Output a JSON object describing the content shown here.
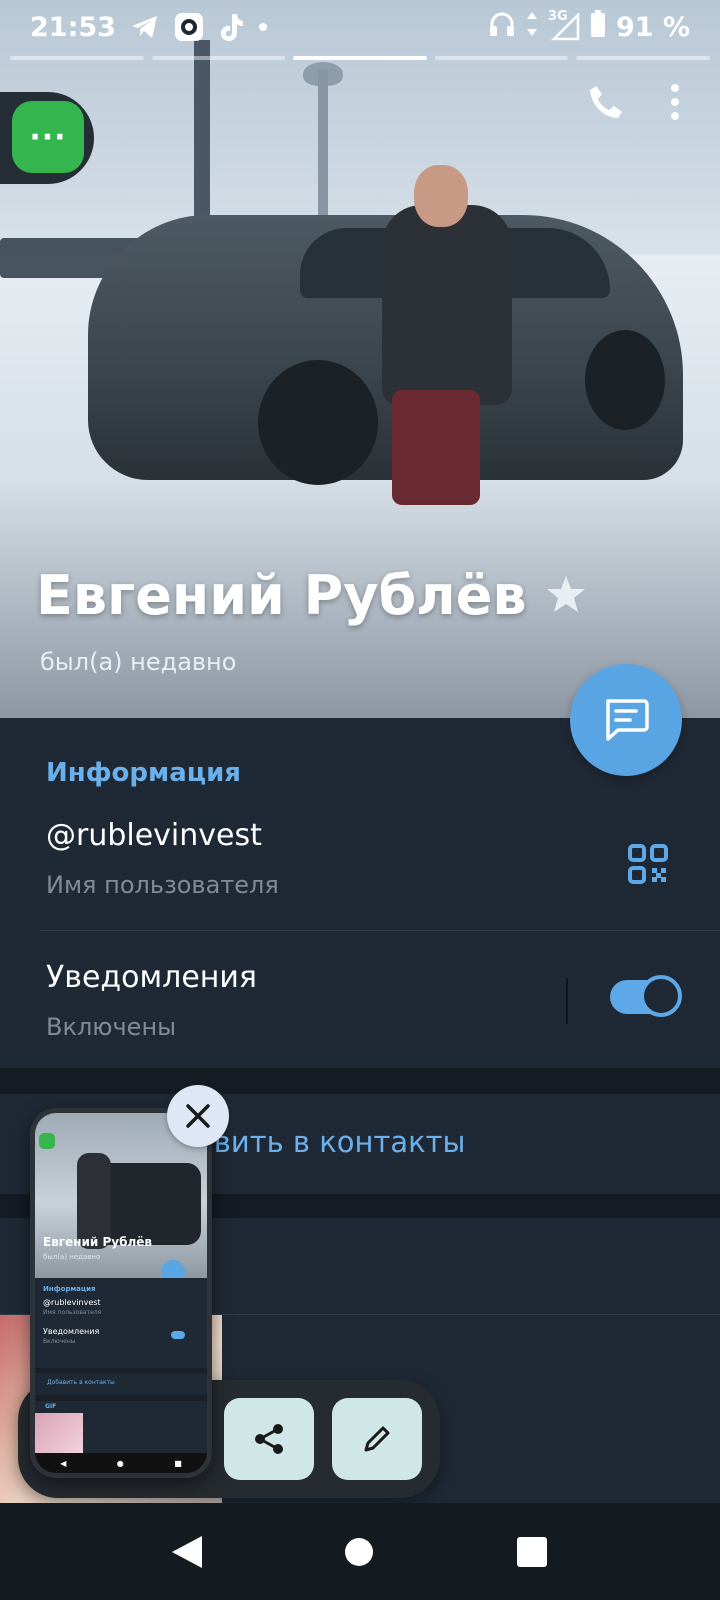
{
  "status_bar": {
    "time": "21:53",
    "network": "3G",
    "battery": "91 %",
    "icons": [
      "telegram-icon",
      "app-icon",
      "tiktok-icon",
      "dot-icon",
      "headphones-icon",
      "signal-icon",
      "battery-icon"
    ]
  },
  "profile": {
    "name": "Евгений Рублёв",
    "status": "был(а) недавно"
  },
  "info": {
    "heading": "Информация",
    "username": "@rublevinvest",
    "username_label": "Имя пользователя",
    "notifications_title": "Уведомления",
    "notifications_state": "Включены",
    "notifications_on": true
  },
  "add_contact": {
    "label": "авить в контакты"
  },
  "green_button": {
    "label": "···"
  },
  "preview": {
    "name": "Евгений Рублёв",
    "status": "был(а) недавно",
    "info_heading": "Информация",
    "username": "@rublevinvest",
    "username_label": "Имя пользователя",
    "notifications_title": "Уведомления",
    "notifications_state": "Включены",
    "add_contact": "Добавить в контакты",
    "gif_label": "GIF"
  },
  "colors": {
    "accent": "#6bb0ea",
    "background": "#1f2935",
    "fab": "#59a5e4",
    "green": "#35b54e"
  }
}
